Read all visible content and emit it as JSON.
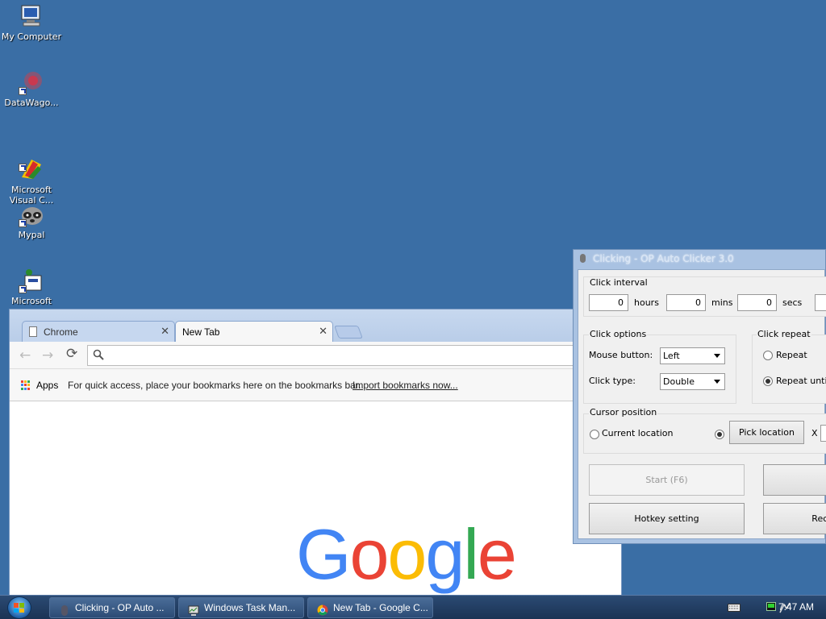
{
  "desktop": {
    "icons": [
      {
        "label": "My Computer",
        "icon": "computer-icon"
      },
      {
        "label": "DataWago...",
        "icon": "datawagon-icon"
      },
      {
        "label": "Microsoft\nVisual C...",
        "icon": "visual-c-icon"
      },
      {
        "label": "Mypal",
        "icon": "mypal-raccoon-icon"
      },
      {
        "label": "Microsoft",
        "icon": "microsoft-app-icon"
      }
    ]
  },
  "chrome": {
    "tabs": [
      {
        "label": "Chrome",
        "active": false
      },
      {
        "label": "New Tab",
        "active": true
      }
    ],
    "close_glyph": "✕",
    "back_glyph": "←",
    "forward_glyph": "→",
    "reload_glyph": "⟳",
    "search_glyph": "🔍",
    "omnibox_value": "",
    "apps_label": "Apps",
    "bookmarks_info": "For quick access, place your bookmarks here on the bookmarks bar.",
    "import_link": "Import bookmarks now...",
    "logo_letters": [
      {
        "ch": "G",
        "color": "#4285f4"
      },
      {
        "ch": "o",
        "color": "#ea4335"
      },
      {
        "ch": "o",
        "color": "#fbbc05"
      },
      {
        "ch": "g",
        "color": "#4285f4"
      },
      {
        "ch": "l",
        "color": "#34a853"
      },
      {
        "ch": "e",
        "color": "#ea4335"
      }
    ]
  },
  "clicker": {
    "title": "Clicking - OP Auto Clicker 3.0",
    "interval": {
      "title": "Click interval",
      "hours_value": "0",
      "hours_label": "hours",
      "mins_value": "0",
      "mins_label": "mins",
      "secs_value": "0",
      "secs_label": "secs"
    },
    "options": {
      "title": "Click options",
      "mouse_button_label": "Mouse button:",
      "mouse_button_value": "Left",
      "click_type_label": "Click type:",
      "click_type_value": "Double"
    },
    "repeat": {
      "title": "Click repeat",
      "repeat_label": "Repeat",
      "repeat_until_label": "Repeat until s",
      "selected": "repeat_until"
    },
    "cursor": {
      "title": "Cursor position",
      "current_label": "Current location",
      "pick_label": "Pick location",
      "x_label": "X",
      "selected": "pick"
    },
    "buttons": {
      "start": "Start (F6)",
      "stop": "S",
      "hotkey": "Hotkey setting",
      "record": "Reco"
    }
  },
  "taskbar": {
    "tasks": [
      {
        "label": "Clicking - OP Auto ...",
        "icon": "mouse-icon"
      },
      {
        "label": "Windows Task Man...",
        "icon": "task-manager-icon"
      },
      {
        "label": "New Tab - Google C...",
        "icon": "chrome-icon"
      }
    ],
    "clock": "7:47 AM"
  }
}
